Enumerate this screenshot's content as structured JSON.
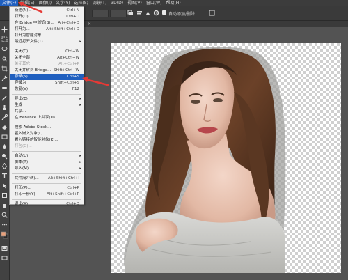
{
  "colors": {
    "accent": "#1f5fbf",
    "annotation": "#e53935",
    "menu_bg": "#f0f0f0",
    "ui_dark": "#3c3c3c"
  },
  "menubar": {
    "items": [
      {
        "label": "文件(F)",
        "active": true
      },
      {
        "label": "编辑(E)"
      },
      {
        "label": "图像(I)"
      },
      {
        "label": "文字(Y)"
      },
      {
        "label": "选择(S)"
      },
      {
        "label": "滤镜(T)"
      },
      {
        "label": "3D(D)"
      },
      {
        "label": "视图(V)"
      },
      {
        "label": "窗口(W)"
      },
      {
        "label": "帮助(H)"
      }
    ]
  },
  "optionsbar": {
    "auto_add_remove": "自动添加/删除",
    "tab_close": "×"
  },
  "file_menu": {
    "items": [
      {
        "label": "新建(N)...",
        "shortcut": "Ctrl+N"
      },
      {
        "label": "打开(O)...",
        "shortcut": "Ctrl+O"
      },
      {
        "label": "在 Bridge 中浏览(B)...",
        "shortcut": "Alt+Ctrl+O"
      },
      {
        "label": "打开为...",
        "shortcut": "Alt+Shift+Ctrl+O"
      },
      {
        "label": "打开为智能对象..."
      },
      {
        "label": "最近打开文件(T)",
        "submenu": true
      },
      {
        "sep": true
      },
      {
        "label": "关闭(C)",
        "shortcut": "Ctrl+W"
      },
      {
        "label": "关闭全部",
        "shortcut": "Alt+Ctrl+W"
      },
      {
        "label": "关闭其它",
        "shortcut": "Alt+Ctrl+P",
        "disabled": true
      },
      {
        "label": "关闭并转到 Bridge...",
        "shortcut": "Shift+Ctrl+W"
      },
      {
        "label": "存储(S)",
        "shortcut": "Ctrl+S",
        "highlighted": true
      },
      {
        "label": "存储为",
        "shortcut": "Shift+Ctrl+S"
      },
      {
        "label": "恢复(V)",
        "shortcut": "F12"
      },
      {
        "sep": true
      },
      {
        "label": "导出(E)",
        "submenu": true
      },
      {
        "label": "生成",
        "submenu": true
      },
      {
        "label": "共享..."
      },
      {
        "label": "在 Behance 上共享(D)..."
      },
      {
        "sep": true
      },
      {
        "label": "搜索 Adobe Stock..."
      },
      {
        "label": "置入嵌入对象(L)..."
      },
      {
        "label": "置入链接的智能对象(K)..."
      },
      {
        "label": "打包(G)...",
        "disabled": true
      },
      {
        "sep": true
      },
      {
        "label": "自动(U)",
        "submenu": true
      },
      {
        "label": "脚本(R)",
        "submenu": true
      },
      {
        "label": "导入(M)",
        "submenu": true
      },
      {
        "sep": true
      },
      {
        "label": "文件简介(F)...",
        "shortcut": "Alt+Shift+Ctrl+I"
      },
      {
        "sep": true
      },
      {
        "label": "打印(P)...",
        "shortcut": "Ctrl+P"
      },
      {
        "label": "打印一份(Y)",
        "shortcut": "Alt+Shift+Ctrl+P"
      },
      {
        "sep": true
      },
      {
        "label": "退出(X)",
        "shortcut": "Ctrl+Q"
      }
    ]
  }
}
